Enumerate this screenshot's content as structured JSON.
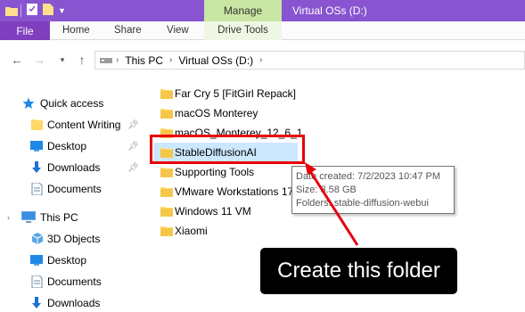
{
  "title_bar": {
    "manage_tab": "Manage",
    "window_title": "Virtual OSs (D:)"
  },
  "ribbon": {
    "tabs": [
      "File",
      "Home",
      "Share",
      "View",
      "Drive Tools"
    ]
  },
  "address_bar": {
    "crumbs": [
      "This PC",
      "Virtual OSs (D:)"
    ]
  },
  "nav_pane": {
    "items": [
      {
        "label": "Quick access",
        "icon": "star-icon"
      },
      {
        "label": "Content Writing",
        "icon": "folder-icon",
        "pinned": true
      },
      {
        "label": "Desktop",
        "icon": "desktop-icon",
        "pinned": true
      },
      {
        "label": "Downloads",
        "icon": "download-icon",
        "pinned": true
      },
      {
        "label": "Documents",
        "icon": "document-icon"
      },
      {
        "label": "This PC",
        "icon": "computer-icon"
      },
      {
        "label": "3D Objects",
        "icon": "cube-icon"
      },
      {
        "label": "Desktop",
        "icon": "desktop-icon"
      },
      {
        "label": "Documents",
        "icon": "document-icon"
      },
      {
        "label": "Downloads",
        "icon": "download-icon"
      }
    ]
  },
  "folders": [
    "Far Cry 5 [FitGirl Repack]",
    "macOS Monterey",
    "macOS_Monterey_12_6_1",
    "StableDiffusionAI",
    "Supporting Tools",
    "VMware Workstations 17",
    "Windows 11 VM",
    "Xiaomi"
  ],
  "tooltip": {
    "date_created": "Date created: 7/2/2023 10:47 PM",
    "size": "Size: 3.58 GB",
    "folders": "Folders: stable-diffusion-webui"
  },
  "callout": {
    "text": "Create this folder"
  },
  "colors": {
    "title_bar": "#8854d0",
    "file_tab": "#7f3fbf",
    "manage_tab": "#c9e6a4",
    "highlight": "#e8000b",
    "folder": "#ffd867"
  }
}
